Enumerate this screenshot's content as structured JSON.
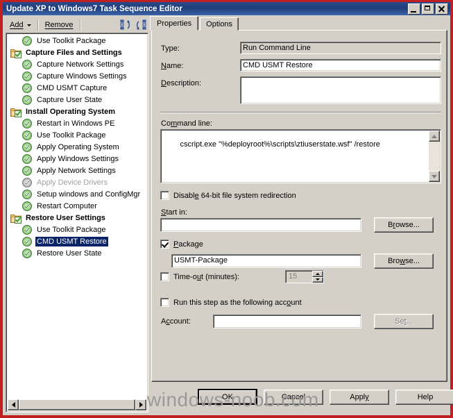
{
  "window": {
    "title": "Update XP to Windows7 Task Sequence Editor",
    "minimize_label": "Minimize",
    "maximize_label": "Maximize",
    "close_label": "Close",
    "border_color": "#c02020",
    "titlebar_color": "#1f3d7a",
    "face_color": "#d4d0c8"
  },
  "toolbar": {
    "add_label": "Add",
    "remove_label": "Remove",
    "move_up_icon": "move-up-icon",
    "move_down_icon": "move-down-icon"
  },
  "tree": {
    "selected_index": 16,
    "items": [
      {
        "label": "Use Toolkit Package",
        "level": 1,
        "icon": "green-check-icon",
        "kind": "step"
      },
      {
        "label": "Capture Files and Settings",
        "level": 0,
        "icon": "folder-check-icon",
        "kind": "group"
      },
      {
        "label": "Capture Network Settings",
        "level": 1,
        "icon": "green-check-icon",
        "kind": "step"
      },
      {
        "label": "Capture Windows Settings",
        "level": 1,
        "icon": "green-check-icon",
        "kind": "step"
      },
      {
        "label": "CMD USMT Capture",
        "level": 1,
        "icon": "green-check-icon",
        "kind": "step"
      },
      {
        "label": "Capture User State",
        "level": 1,
        "icon": "green-check-icon",
        "kind": "step"
      },
      {
        "label": "Install Operating System",
        "level": 0,
        "icon": "folder-check-icon",
        "kind": "group"
      },
      {
        "label": "Restart in Windows PE",
        "level": 1,
        "icon": "green-check-icon",
        "kind": "step"
      },
      {
        "label": "Use Toolkit Package",
        "level": 1,
        "icon": "green-check-icon",
        "kind": "step"
      },
      {
        "label": "Apply Operating System",
        "level": 1,
        "icon": "green-check-icon",
        "kind": "step"
      },
      {
        "label": "Apply Windows Settings",
        "level": 1,
        "icon": "green-check-icon",
        "kind": "step"
      },
      {
        "label": "Apply Network Settings",
        "level": 1,
        "icon": "green-check-icon",
        "kind": "step"
      },
      {
        "label": "Apply Device Drivers",
        "level": 1,
        "icon": "gray-check-icon",
        "kind": "disabled"
      },
      {
        "label": "Setup windows and ConfigMgr",
        "level": 1,
        "icon": "green-check-icon",
        "kind": "step"
      },
      {
        "label": "Restart Computer",
        "level": 1,
        "icon": "green-check-icon",
        "kind": "step"
      },
      {
        "label": "Restore User Settings",
        "level": 0,
        "icon": "folder-check-icon",
        "kind": "group"
      },
      {
        "label": "Use Toolkit Package",
        "level": 1,
        "icon": "green-check-icon",
        "kind": "step"
      },
      {
        "label": "CMD USMT Restore",
        "level": 1,
        "icon": "green-check-icon",
        "kind": "selected"
      },
      {
        "label": "Restore User State",
        "level": 1,
        "icon": "green-check-icon",
        "kind": "step"
      }
    ]
  },
  "tabs": [
    {
      "label": "Properties",
      "active": true
    },
    {
      "label": "Options",
      "active": false
    }
  ],
  "properties": {
    "type_label": "Type:",
    "type_value": "Run Command Line",
    "name_label": "Name:",
    "name_underline": "N",
    "name_value": "CMD USMT Restore",
    "description_label": "Description:",
    "description_value": "",
    "command_line_label": "Command line:",
    "command_line_value": "cscript.exe \"%deployroot%\\scripts\\ztiuserstate.wsf\" /restore",
    "disable_redirection_label": "Disable 64-bit file system redirection",
    "disable_redirection_checked": false,
    "start_in_label": "Start in:",
    "start_in_value": "",
    "start_in_browse_label": "Browse...",
    "package_label": "Package",
    "package_checked": true,
    "package_value": "USMT-Package",
    "package_browse_label": "Browse...",
    "timeout_label": "Time-out (minutes):",
    "timeout_checked": false,
    "timeout_value": "15",
    "run_as_label": "Run this step as the following account",
    "run_as_checked": false,
    "account_label": "Account:",
    "account_value": "",
    "account_set_label": "Set...",
    "account_set_disabled": true
  },
  "dialog_buttons": {
    "ok": "OK",
    "cancel": "Cancel",
    "apply": "Apply",
    "help": "Help",
    "default_button": "OK"
  },
  "watermark": {
    "text": "windows-noob.com",
    "color": "#9a9a9a"
  }
}
